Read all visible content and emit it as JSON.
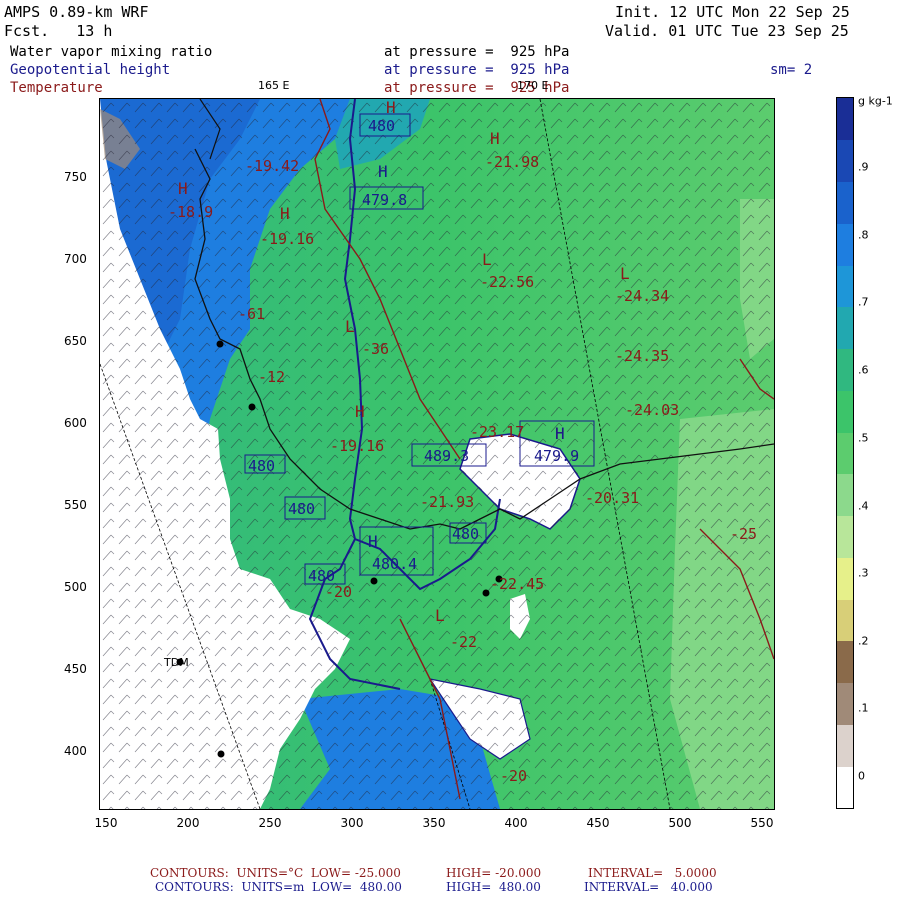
{
  "header": {
    "model": "AMPS 0.89-km WRF",
    "init": "Init. 12 UTC Mon 22 Sep 25",
    "forecast": "Fcst.   13 h",
    "valid": "Valid. 01 UTC Tue 23 Sep 25",
    "field1": "Water vapor mixing ratio",
    "field1_level": "at pressure =  925 hPa",
    "field2": "Geopotential height",
    "field2_level": "at pressure =  925 hPa",
    "smoothing": "sm= 2",
    "field3": "Temperature",
    "field3_level": "at pressure =  925 hPa",
    "meridian_165": "165 E",
    "meridian_170": "170 E"
  },
  "axes": {
    "x_ticks": [
      "150",
      "200",
      "250",
      "300",
      "350",
      "400",
      "450",
      "500",
      "550"
    ],
    "y_ticks": [
      "750",
      "700",
      "650",
      "600",
      "550",
      "500",
      "450",
      "400"
    ]
  },
  "colorbar": {
    "unit": "g kg-1",
    "levels": [
      "0",
      ".1",
      ".2",
      ".3",
      ".4",
      ".5",
      ".6",
      ".7",
      ".8",
      ".9"
    ],
    "colors": [
      "#ffffff",
      "#dcd2cc",
      "#a08a78",
      "#8a6a4a",
      "#d8cf78",
      "#e6f08a",
      "#b8e69a",
      "#8cd98c",
      "#5ccc6e",
      "#3cc46a",
      "#30b880",
      "#22a8b0",
      "#1e96d8",
      "#1e7ee0",
      "#1a62cc",
      "#1a48b4",
      "#1a2e96"
    ]
  },
  "annotations": {
    "heights": [
      "480",
      "479.8",
      "489.3",
      "479.9",
      "480",
      "480",
      "480.4",
      "480",
      "480"
    ],
    "temperatures": [
      "-21.98",
      "-22.56",
      "-24.34",
      "-24.35",
      "-24.03",
      "-23.17",
      "-20.31",
      "-21.93",
      "-22.45",
      "-22",
      "-20",
      "-25",
      "-19.42",
      "-19.16",
      "-18.9",
      "-19.16",
      "-20",
      "-61",
      "-12",
      "-36"
    ],
    "station": "TDM"
  },
  "footer": {
    "line1_a": "CONTOURS:  UNITS=°C  LOW= -25.000",
    "line1_b": "HIGH= -20.000",
    "line1_c": "INTERVAL=   5.0000",
    "line2_a": "CONTOURS:  UNITS=m  LOW=  480.00",
    "line2_b": "HIGH=  480.00",
    "line2_c": "INTERVAL=   40.000"
  }
}
